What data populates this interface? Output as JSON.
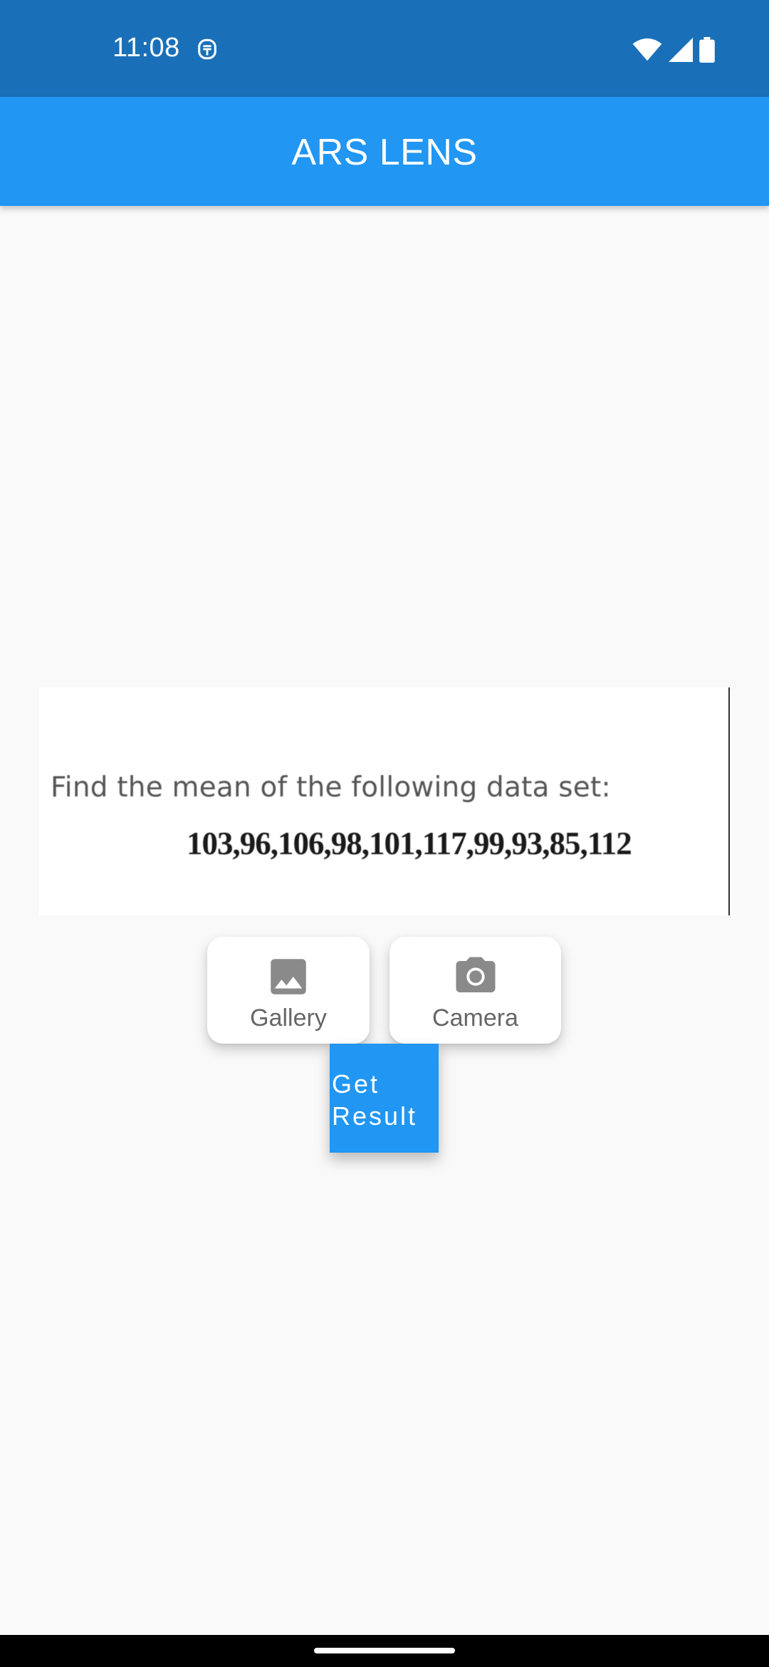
{
  "status_bar": {
    "time": "11:08",
    "notification_icon": "notification-app-icon",
    "icons": [
      "wifi-icon",
      "signal-icon",
      "battery-icon"
    ],
    "background_color": "#1a70b8"
  },
  "app_bar": {
    "title": "ARS LENS",
    "background_color": "#2196f3"
  },
  "picked_image": {
    "question": "Find the mean of the following data set:",
    "numbers": "103,96,106,98,101,117,99,93,85,112"
  },
  "buttons": {
    "gallery": {
      "label": "Gallery",
      "icon": "image-icon"
    },
    "camera": {
      "label": "Camera",
      "icon": "camera-icon"
    },
    "get_result": {
      "label": "Get Result"
    }
  },
  "colors": {
    "accent": "#2196f3",
    "background": "#f9f9f9",
    "button_text": "#666666"
  }
}
